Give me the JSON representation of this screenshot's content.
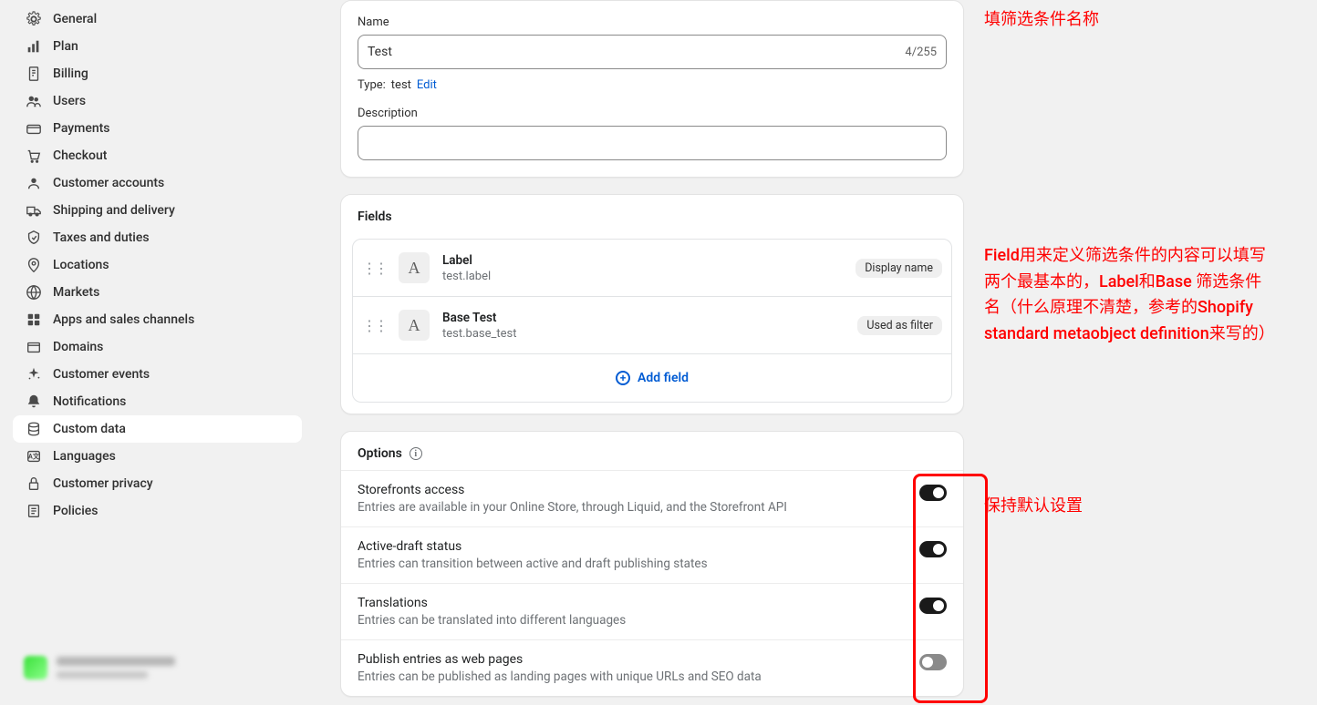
{
  "sidebar": {
    "items": [
      {
        "label": "General"
      },
      {
        "label": "Plan"
      },
      {
        "label": "Billing"
      },
      {
        "label": "Users"
      },
      {
        "label": "Payments"
      },
      {
        "label": "Checkout"
      },
      {
        "label": "Customer accounts"
      },
      {
        "label": "Shipping and delivery"
      },
      {
        "label": "Taxes and duties"
      },
      {
        "label": "Locations"
      },
      {
        "label": "Markets"
      },
      {
        "label": "Apps and sales channels"
      },
      {
        "label": "Domains"
      },
      {
        "label": "Customer events"
      },
      {
        "label": "Notifications"
      },
      {
        "label": "Custom data"
      },
      {
        "label": "Languages"
      },
      {
        "label": "Customer privacy"
      },
      {
        "label": "Policies"
      }
    ]
  },
  "form": {
    "name_label": "Name",
    "name_value": "Test",
    "name_counter": "4/255",
    "type_label": "Type:",
    "type_value": "test",
    "edit_label": "Edit",
    "description_label": "Description",
    "description_value": ""
  },
  "fields": {
    "title": "Fields",
    "rows": [
      {
        "name": "Label",
        "key": "test.label",
        "tag": "Display name"
      },
      {
        "name": "Base Test",
        "key": "test.base_test",
        "tag": "Used as filter"
      }
    ],
    "add_label": "Add field"
  },
  "options": {
    "title": "Options",
    "rows": [
      {
        "name": "Storefronts access",
        "desc": "Entries are available in your Online Store, through Liquid, and the Storefront API",
        "on": true
      },
      {
        "name": "Active-draft status",
        "desc": "Entries can transition between active and draft publishing states",
        "on": true
      },
      {
        "name": "Translations",
        "desc": "Entries can be translated into different languages",
        "on": true
      },
      {
        "name": "Publish entries as web pages",
        "desc": "Entries can be published as landing pages with unique URLs and SEO data",
        "on": false
      }
    ]
  },
  "annotations": {
    "a1": "填筛选条件名称",
    "a2": "Field用来定义筛选条件的内容可以填写两个最基本的，Label和Base 筛选条件名（什么原理不清楚，参考的Shopify standard metaobject definition来写的）",
    "a3": "保持默认设置"
  }
}
